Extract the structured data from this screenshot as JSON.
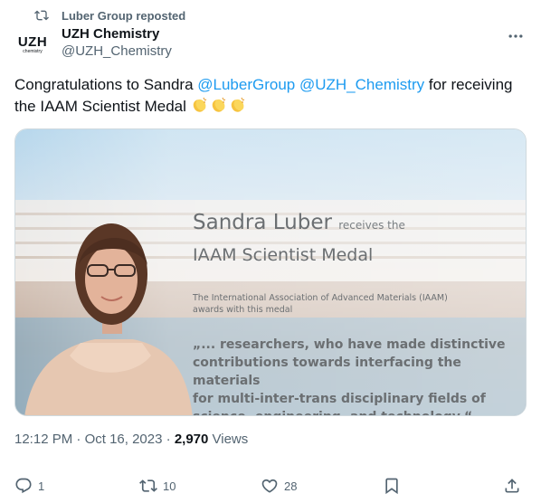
{
  "repost": {
    "label": "Luber Group reposted"
  },
  "author": {
    "name": "UZH Chemistry",
    "handle": "@UZH_Chemistry",
    "avatar_main": "UZH",
    "avatar_sub": "chemistry"
  },
  "tweet": {
    "text_prefix": "Congratulations to Sandra ",
    "mention1": "@LuberGroup",
    "space": " ",
    "mention2": "@UZH_Chemistry",
    "text_middle": " for receiving the IAAM Scientist Medal ",
    "emoji": "clapping-hands x3",
    "mention_color": "#1d9bf0"
  },
  "media": {
    "name": "Sandra Luber",
    "receives": "receives the",
    "medal": "IAAM Scientist Medal",
    "iaam_line1": "The International Association of Advanced Materials (IAAM)",
    "iaam_line2": "awards with this medal",
    "quote_line1": "„... researchers, who have made distinctive",
    "quote_line2": "contributions towards interfacing the materials",
    "quote_line3": "for multi-inter-trans disciplinary fields of",
    "quote_line4": "science, engineering, and technology.“"
  },
  "meta": {
    "time": "12:12 PM",
    "sep": " · ",
    "date": "Oct 16, 2023",
    "views_count": "2,970",
    "views_label": " Views"
  },
  "actions": {
    "replies": "1",
    "reposts": "10",
    "likes": "28"
  }
}
